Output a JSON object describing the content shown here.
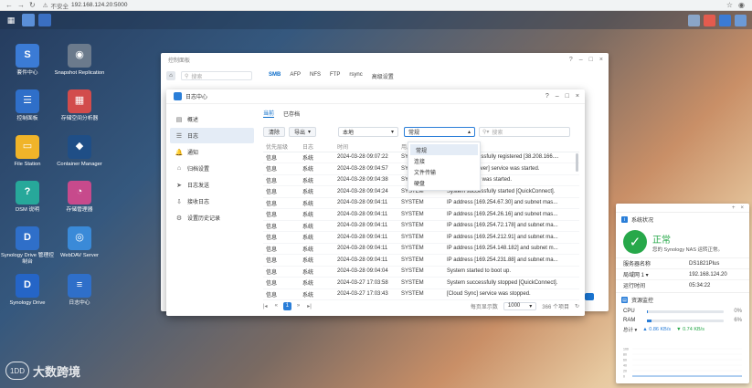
{
  "browser": {
    "insecure_label": "不安全",
    "url": "192.168.124.20:5000"
  },
  "desktop_icons": [
    {
      "label": "套件中心",
      "color": "#3b7bd5",
      "glyph": "S"
    },
    {
      "label": "Snapshot Replication",
      "color": "#6b7a8c",
      "glyph": "◉"
    },
    {
      "label": "控制面板",
      "color": "#2f6fc9",
      "glyph": "☰"
    },
    {
      "label": "存储空间分析器",
      "color": "#d24c4c",
      "glyph": "▦"
    },
    {
      "label": "File Station",
      "color": "#f0b429",
      "glyph": "▭"
    },
    {
      "label": "Container Manager",
      "color": "#1f4e86",
      "glyph": "◆"
    },
    {
      "label": "DSM 说明",
      "color": "#27a89a",
      "glyph": "?"
    },
    {
      "label": "存储管理器",
      "color": "#c74a8c",
      "glyph": "◔"
    },
    {
      "label": "Synology Drive 管理控制台",
      "color": "#2f6fc9",
      "glyph": "D"
    },
    {
      "label": "WebDAV Server",
      "color": "#3a8ad8",
      "glyph": "◎"
    },
    {
      "label": "Synology Drive",
      "color": "#2565c7",
      "glyph": "D"
    },
    {
      "label": "日志中心",
      "color": "#2f6fc9",
      "glyph": "≡"
    }
  ],
  "back_window": {
    "title": "控制面板",
    "search_placeholder": "搜索",
    "tabs": [
      "SMB",
      "AFP",
      "NFS",
      "FTP",
      "rsync",
      "高级设置"
    ]
  },
  "log_window": {
    "title": "日志中心",
    "sidebar": [
      {
        "icon": "▤",
        "label": "概述"
      },
      {
        "icon": "☰",
        "label": "日志"
      },
      {
        "icon": "🔔",
        "label": "通知"
      },
      {
        "icon": "⌂",
        "label": "归档设置"
      },
      {
        "icon": "➤",
        "label": "日志发送"
      },
      {
        "icon": "⇩",
        "label": "接收日志"
      },
      {
        "icon": "⚙",
        "label": "设置历史记录"
      }
    ],
    "tabs": [
      "当前",
      "已存档"
    ],
    "buttons": {
      "clear": "清除",
      "export": "导出"
    },
    "filter_location": "本地",
    "filter_type": "常规",
    "search_placeholder": "搜索",
    "columns": [
      "优先层级",
      "日志",
      "时间",
      "用户",
      "事件"
    ],
    "rows": [
      [
        "信息",
        "系统",
        "2024-03-28 09:07:22",
        "SYSTEM",
        "System successfully registered [38.208.166...."
      ],
      [
        "信息",
        "系统",
        "2024-03-28 09:04:57",
        "SYSTEM",
        "[WebDAV Server] service was started."
      ],
      [
        "信息",
        "系统",
        "2024-03-28 09:04:38",
        "SYSTEM",
        "[SMB] service was started."
      ],
      [
        "信息",
        "系统",
        "2024-03-28 09:04:24",
        "SYSTEM",
        "System successfully started [QuickConnect]."
      ],
      [
        "信息",
        "系统",
        "2024-03-28 09:04:11",
        "SYSTEM",
        "IP address [169.254.67.30] and subnet mas..."
      ],
      [
        "信息",
        "系统",
        "2024-03-28 09:04:11",
        "SYSTEM",
        "IP address [169.254.26.16] and subnet mas..."
      ],
      [
        "信息",
        "系统",
        "2024-03-28 09:04:11",
        "SYSTEM",
        "IP address [169.254.72.178] and subnet ma..."
      ],
      [
        "信息",
        "系统",
        "2024-03-28 09:04:11",
        "SYSTEM",
        "IP address [169.254.212.91] and subnet ma..."
      ],
      [
        "信息",
        "系统",
        "2024-03-28 09:04:11",
        "SYSTEM",
        "IP address [169.254.148.182] and subnet m..."
      ],
      [
        "信息",
        "系统",
        "2024-03-28 09:04:11",
        "SYSTEM",
        "IP address [169.254.231.88] and subnet ma..."
      ],
      [
        "信息",
        "系统",
        "2024-03-28 09:04:04",
        "SYSTEM",
        "System started to boot up."
      ],
      [
        "信息",
        "系统",
        "2024-03-27 17:03:58",
        "SYSTEM",
        "System successfully stopped [QuickConnect]."
      ],
      [
        "信息",
        "系统",
        "2024-03-27 17:03:43",
        "SYSTEM",
        "[Cloud Sync] service was stopped."
      ]
    ],
    "pager": {
      "current_page": "1",
      "per_page_label": "每页显示数",
      "per_page_value": "1000",
      "total_label": "366 个项目"
    },
    "dropdown_options": [
      "常规",
      "连接",
      "文件传输",
      "硬盘"
    ],
    "dropdown_selected": "常规"
  },
  "widget": {
    "status_title": "系统状况",
    "status_text": "正常",
    "status_sub": "您的 Synology NAS 运转正常。",
    "info": [
      {
        "k": "服务器名称",
        "v": "DS1821Plus"
      },
      {
        "k": "局域网 1 ▾",
        "v": "192.168.124.20"
      },
      {
        "k": "运行时间",
        "v": "05:34:22"
      }
    ],
    "monitor_title": "资源监控",
    "cpu": {
      "label": "CPU",
      "value": 0,
      "text": "0%"
    },
    "ram": {
      "label": "RAM",
      "value": 6,
      "text": "6%"
    },
    "total_label": "总计 ▾",
    "net_up": "▲ 0.86 KB/s",
    "net_down": "▼ 0.74 KB/s",
    "chart_ticks": [
      "100",
      "80",
      "60",
      "40",
      "20",
      "0"
    ]
  },
  "watermark": "大数跨境",
  "colors": {
    "accent": "#2a7ed8",
    "ok": "#27a84a"
  }
}
